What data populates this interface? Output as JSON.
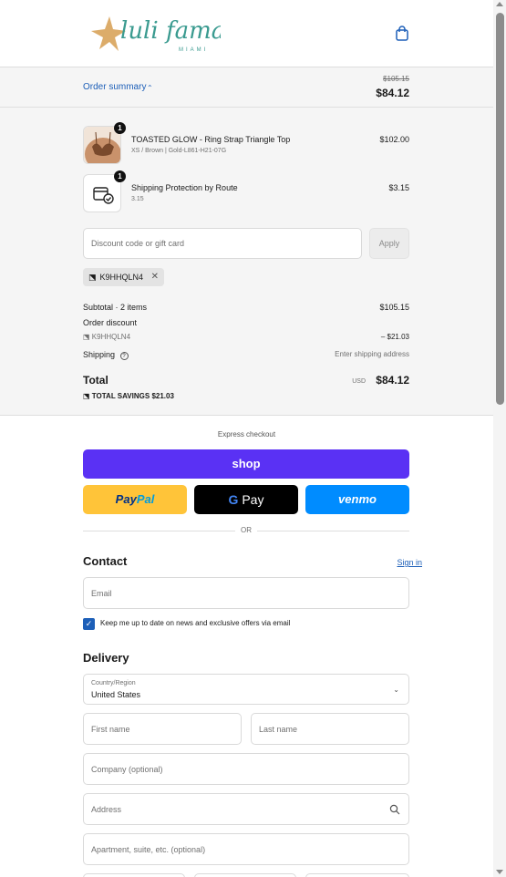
{
  "brand": {
    "name": "luli fama",
    "city": "MIAMI"
  },
  "summary": {
    "toggle_label": "Order summary",
    "original_price": "$105.15",
    "total_price": "$84.12",
    "items": [
      {
        "title": "TOASTED GLOW - Ring Strap Triangle Top",
        "subtitle": "XS / Brown | Gold-L861-H21-07G",
        "price": "$102.00",
        "qty": "1"
      },
      {
        "title": "Shipping Protection by Route",
        "subtitle": "3.15",
        "price": "$3.15",
        "qty": "1"
      }
    ],
    "discount_placeholder": "Discount code or gift card",
    "apply_label": "Apply",
    "applied_code": "K9HHQLN4",
    "subtotal_label": "Subtotal · 2 items",
    "subtotal_value": "$105.15",
    "order_discount_label": "Order discount",
    "discount_code": "K9HHQLN4",
    "discount_value": "– $21.03",
    "shipping_label": "Shipping",
    "shipping_value": "Enter shipping address",
    "total_label": "Total",
    "currency": "USD",
    "total_value": "$84.12",
    "savings_label": "TOTAL SAVINGS",
    "savings_value": "$21.03"
  },
  "express": {
    "label": "Express checkout",
    "shop": "shop",
    "paypal_a": "Pay",
    "paypal_b": "Pal",
    "gpay": "Pay",
    "venmo": "venmo",
    "or": "OR"
  },
  "contact": {
    "title": "Contact",
    "signin": "Sign in",
    "email_placeholder": "Email",
    "newsletter": "Keep me up to date on news and exclusive offers via email",
    "newsletter_checked": true
  },
  "delivery": {
    "title": "Delivery",
    "country_label": "Country/Region",
    "country_value": "United States",
    "first_name": "First name",
    "last_name": "Last name",
    "company": "Company (optional)",
    "address": "Address",
    "apartment": "Apartment, suite, etc. (optional)"
  },
  "colors": {
    "accent": "#1d5fb8",
    "shop": "#5a31f4",
    "paypal": "#ffc439",
    "venmo": "#008cff"
  }
}
